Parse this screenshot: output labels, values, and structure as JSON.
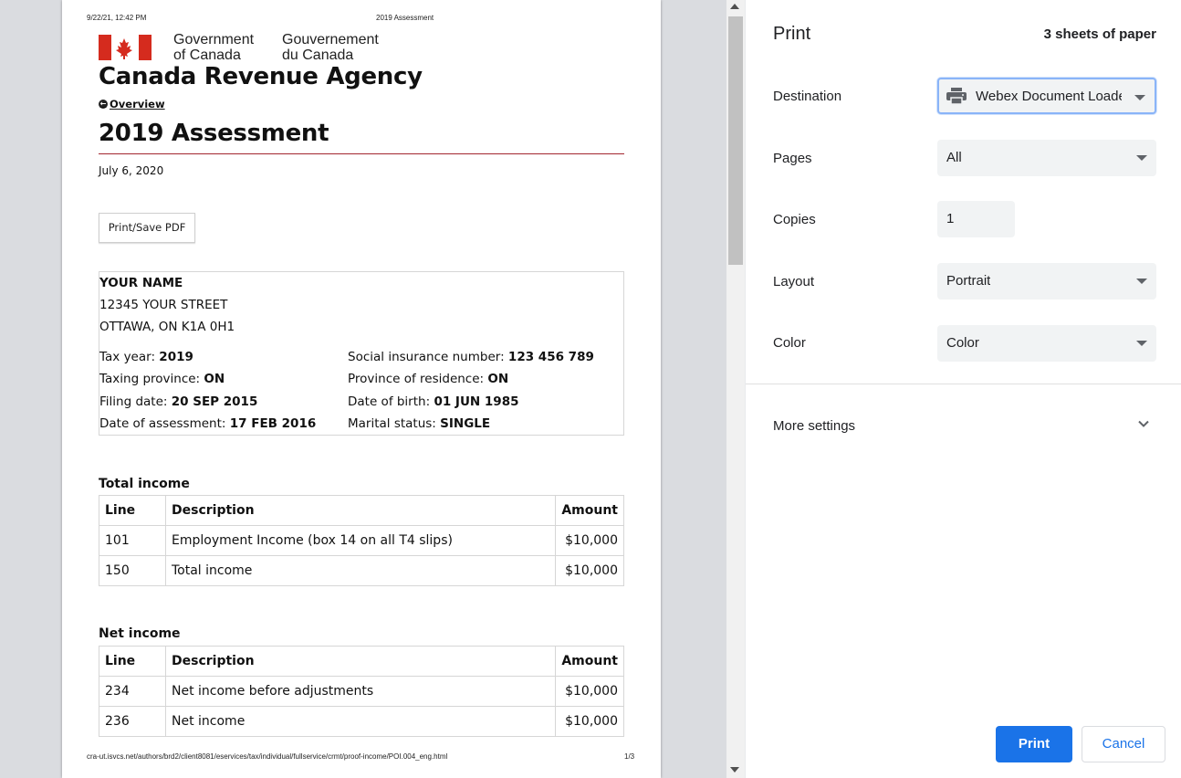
{
  "preview": {
    "header_left": "9/22/21, 12:42 PM",
    "header_center": "2019 Assessment",
    "footer_url": "cra-ut.isvcs.net/authors/brd2/client8081/eservices/tax/individual/fullservice/crmt/proof-income/POI.004_eng.html",
    "footer_page": "1/3",
    "gov_en_1": "Government",
    "gov_en_2": "of Canada",
    "gov_fr_1": "Gouvernement",
    "gov_fr_2": "du Canada",
    "agency": "Canada Revenue Agency",
    "overview_link": "Overview",
    "title": "2019 Assessment",
    "date": "July 6, 2020",
    "pdf_button": "Print/Save PDF",
    "info": {
      "name": "YOUR NAME",
      "street": "12345 YOUR STREET",
      "city": "OTTAWA, ON K1A 0H1",
      "tax_year_label": "Tax year:",
      "tax_year": "2019",
      "province_label": "Taxing province:",
      "province": "ON",
      "filing_label": "Filing date:",
      "filing": "20 SEP 2015",
      "assessment_label": "Date of assessment:",
      "assessment": "17 FEB 2016",
      "sin_label": "Social insurance number:",
      "sin": "123 456 789",
      "residence_label": "Province of residence:",
      "residence": "ON",
      "dob_label": "Date of birth:",
      "dob": "01 JUN 1985",
      "marital_label": "Marital status:",
      "marital": "SINGLE"
    },
    "total_income": {
      "heading": "Total income",
      "headers": [
        "Line",
        "Description",
        "Amount"
      ],
      "rows": [
        [
          "101",
          "Employment Income (box 14 on all T4 slips)",
          "$10,000"
        ],
        [
          "150",
          "Total income",
          "$10,000"
        ]
      ]
    },
    "net_income": {
      "heading": "Net income",
      "headers": [
        "Line",
        "Description",
        "Amount"
      ],
      "rows": [
        [
          "234",
          "Net income before adjustments",
          "$10,000"
        ],
        [
          "236",
          "Net income",
          "$10,000"
        ]
      ]
    }
  },
  "panel": {
    "title": "Print",
    "sheets": "3 sheets of paper",
    "destination_label": "Destination",
    "destination_value": "Webex Document Loader",
    "pages_label": "Pages",
    "pages_value": "All",
    "copies_label": "Copies",
    "copies_value": "1",
    "layout_label": "Layout",
    "layout_value": "Portrait",
    "color_label": "Color",
    "color_value": "Color",
    "more_settings": "More settings",
    "print_button": "Print",
    "cancel_button": "Cancel",
    "accent_color": "#1a73e8"
  }
}
